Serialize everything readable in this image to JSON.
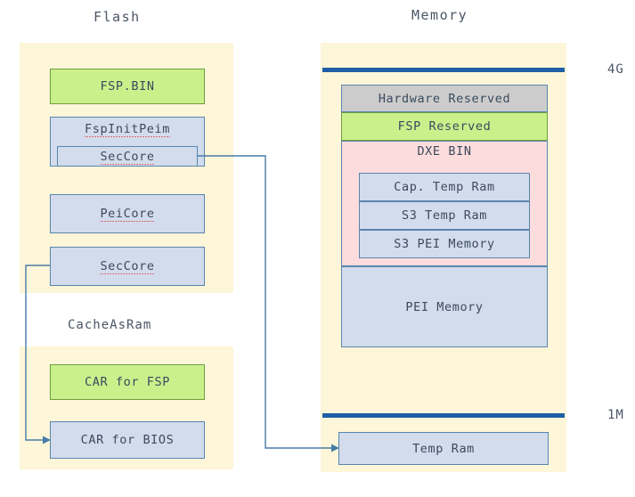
{
  "diagram": {
    "columns": [
      {
        "title": "Flash"
      },
      {
        "title": "Memory"
      }
    ],
    "flash": {
      "blocks": [
        {
          "label": "FSP.BIN",
          "color": "green"
        },
        {
          "label": "FspInitPeim",
          "color": "blue"
        },
        {
          "label": "SecCore",
          "color": "blue"
        },
        {
          "label": "PeiCore",
          "color": "blue"
        },
        {
          "label": "SecCore",
          "color": "blue"
        }
      ]
    },
    "cacheasram": {
      "caption": "CacheAsRam",
      "blocks": [
        {
          "label": "CAR for FSP",
          "color": "green"
        },
        {
          "label": "CAR for BIOS",
          "color": "blue"
        }
      ]
    },
    "memory": {
      "markers": [
        {
          "label": "4G"
        },
        {
          "label": "1M"
        }
      ],
      "blocks": [
        {
          "label": "Hardware Reserved",
          "color": "gray"
        },
        {
          "label": "FSP Reserved",
          "color": "green"
        },
        {
          "label": "DXE BIN",
          "color": "pink"
        },
        {
          "label": "Cap. Temp Ram",
          "color": "blue"
        },
        {
          "label": "S3 Temp Ram",
          "color": "blue"
        },
        {
          "label": "S3 PEI Memory",
          "color": "blue"
        },
        {
          "label": "PEI Memory",
          "color": "blue"
        },
        {
          "label": "Temp Ram",
          "color": "blue"
        }
      ]
    },
    "colors": {
      "region_fill": "#fdf6d8",
      "blue_fill": "#d2dcec",
      "green_fill": "#caf08c",
      "gray_fill": "#cccccc",
      "pink_fill": "#fcdcdc",
      "border": "#5a85ae",
      "bar": "#1f5fa8",
      "text": "#3b4a5e"
    }
  }
}
